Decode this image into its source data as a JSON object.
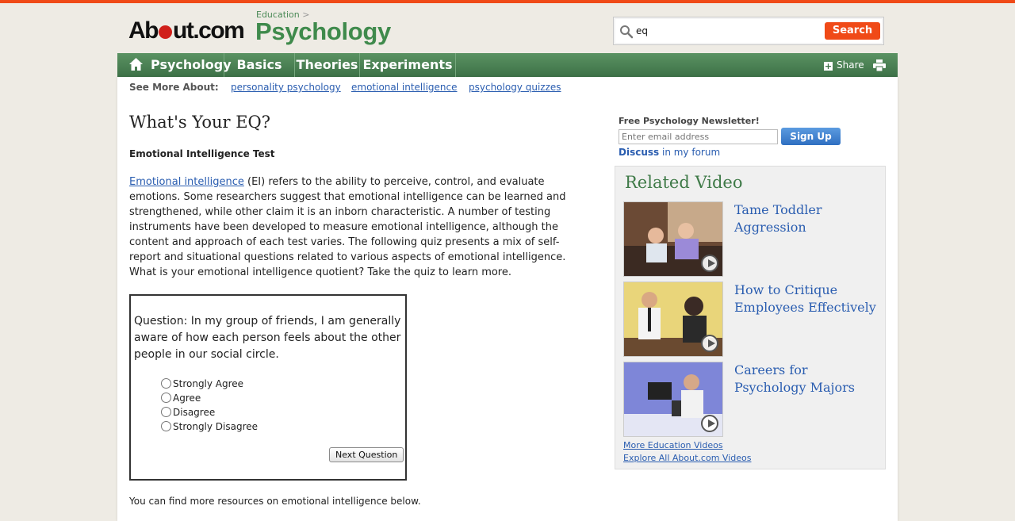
{
  "header": {
    "logo_left": "Ab",
    "logo_right": "ut.com",
    "breadcrumb": "Education",
    "breadcrumb_sep": ">",
    "channel": "Psychology",
    "search_value": "eq",
    "search_button": "Search"
  },
  "nav": {
    "items": [
      "Psychology",
      "Basics",
      "Theories",
      "Experiments"
    ],
    "share": "Share"
  },
  "see_more": {
    "label": "See More About:",
    "links": [
      "personality psychology",
      "emotional intelligence",
      "psychology quizzes"
    ]
  },
  "article": {
    "title": "What's Your EQ?",
    "subtitle": "Emotional Intelligence Test",
    "intro_link": "Emotional intelligence",
    "intro_rest": " (EI) refers to the ability to perceive, control, and evaluate emotions. Some researchers suggest that emotional intelligence can be learned and strengthened, while other claim it is an inborn characteristic. A number of testing instruments have been developed to measure emotional intelligence, although the content and approach of each test varies. The following quiz presents a mix of self-report and situational questions related to various aspects of emotional intelligence. What is your emotional intelligence quotient? Take the quiz to learn more.",
    "footer": "You can find more resources on emotional intelligence below."
  },
  "quiz": {
    "question": "Question: In my group of friends, I am generally aware of how each person feels about the other people in our social circle.",
    "options": [
      "Strongly Agree",
      "Agree",
      "Disagree",
      "Strongly Disagree"
    ],
    "next_button": "Next Question"
  },
  "newsletter": {
    "label": "Free Psychology Newsletter!",
    "placeholder": "Enter email address",
    "button": "Sign Up",
    "discuss_bold": "Discuss",
    "discuss_rest": " in my forum"
  },
  "related_video": {
    "heading": "Related Video",
    "videos": [
      {
        "title": "Tame Toddler Aggression"
      },
      {
        "title": "How to Critique Employees Effectively"
      },
      {
        "title": "Careers for Psychology Majors"
      }
    ],
    "more_link": "More Education Videos",
    "explore_link": "Explore All About.com Videos"
  },
  "colors": {
    "accent_orange": "#f04a17",
    "nav_green": "#3d7147",
    "channel_green": "#3f8a4c",
    "link_blue": "#2a5db0"
  }
}
